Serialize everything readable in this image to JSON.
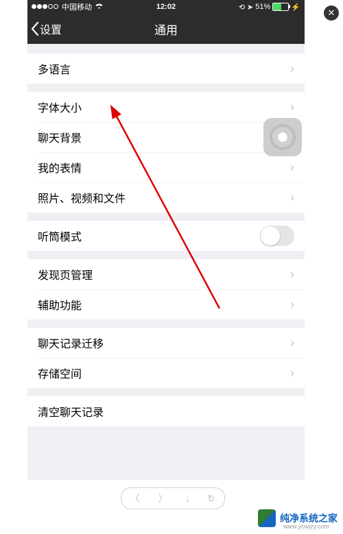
{
  "statusbar": {
    "carrier": "中国移动",
    "time": "12:02",
    "battery_pct": "51%"
  },
  "nav": {
    "back": "设置",
    "title": "通用"
  },
  "groups": [
    {
      "cells": [
        {
          "id": "multilang",
          "label": "多语言",
          "type": "chevron"
        }
      ]
    },
    {
      "cells": [
        {
          "id": "fontsize",
          "label": "字体大小",
          "type": "chevron"
        },
        {
          "id": "chatbg",
          "label": "聊天背景",
          "type": "chevron"
        },
        {
          "id": "stickers",
          "label": "我的表情",
          "type": "chevron"
        },
        {
          "id": "files",
          "label": "照片、视频和文件",
          "type": "chevron"
        }
      ]
    },
    {
      "cells": [
        {
          "id": "earpiece",
          "label": "听筒模式",
          "type": "toggle",
          "on": false
        }
      ]
    },
    {
      "cells": [
        {
          "id": "discover",
          "label": "发现页管理",
          "type": "chevron"
        },
        {
          "id": "accessibility",
          "label": "辅助功能",
          "type": "chevron"
        }
      ]
    },
    {
      "cells": [
        {
          "id": "migrate",
          "label": "聊天记录迁移",
          "type": "chevron"
        },
        {
          "id": "storage",
          "label": "存储空间",
          "type": "chevron"
        }
      ]
    },
    {
      "cells": [
        {
          "id": "clear",
          "label": "清空聊天记录",
          "type": "center"
        }
      ]
    }
  ],
  "watermark": {
    "brand": "纯净系统之家",
    "site": "www.ycwjzy.com"
  },
  "bottombar": {
    "prev": "〈",
    "next": "〉",
    "download": "↓",
    "refresh": "↻"
  }
}
